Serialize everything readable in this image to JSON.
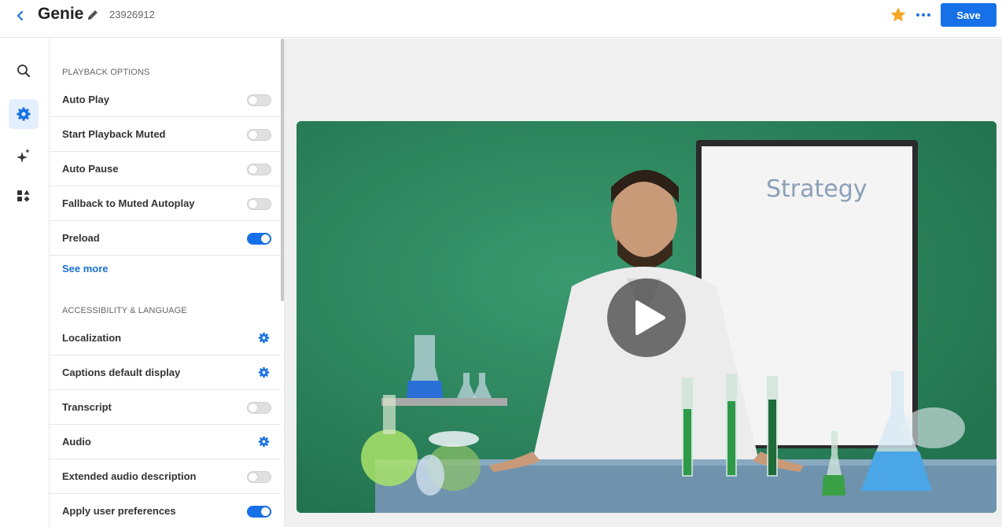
{
  "header": {
    "title": "Genie",
    "player_id": "23926912",
    "save_label": "Save"
  },
  "rail": {
    "items": [
      {
        "name": "search",
        "icon": "search-icon",
        "active": false
      },
      {
        "name": "settings",
        "icon": "gear-icon",
        "active": true
      },
      {
        "name": "ai",
        "icon": "sparkle-icon",
        "active": false
      },
      {
        "name": "plugins",
        "icon": "shapes-icon",
        "active": false
      }
    ]
  },
  "playback": {
    "section_title": "PLAYBACK OPTIONS",
    "rows": [
      {
        "label": "Auto Play",
        "control": "toggle",
        "on": false
      },
      {
        "label": "Start Playback Muted",
        "control": "toggle",
        "on": false
      },
      {
        "label": "Auto Pause",
        "control": "toggle",
        "on": false
      },
      {
        "label": "Fallback to Muted Autoplay",
        "control": "toggle",
        "on": false
      },
      {
        "label": "Preload",
        "control": "toggle",
        "on": true
      }
    ],
    "see_more": "See more"
  },
  "accessibility": {
    "section_title": "ACCESSIBILITY & LANGUAGE",
    "rows": [
      {
        "label": "Localization",
        "control": "gear"
      },
      {
        "label": "Captions default display",
        "control": "gear"
      },
      {
        "label": "Transcript",
        "control": "toggle",
        "on": false
      },
      {
        "label": "Audio",
        "control": "gear"
      },
      {
        "label": "Extended audio description",
        "control": "toggle",
        "on": false
      },
      {
        "label": "Apply user preferences",
        "control": "toggle",
        "on": true
      }
    ]
  },
  "video": {
    "whiteboard_text": "Strategy"
  },
  "colors": {
    "accent": "#1670e8",
    "star": "#f5a623",
    "video_bg": "#2e8a63"
  }
}
